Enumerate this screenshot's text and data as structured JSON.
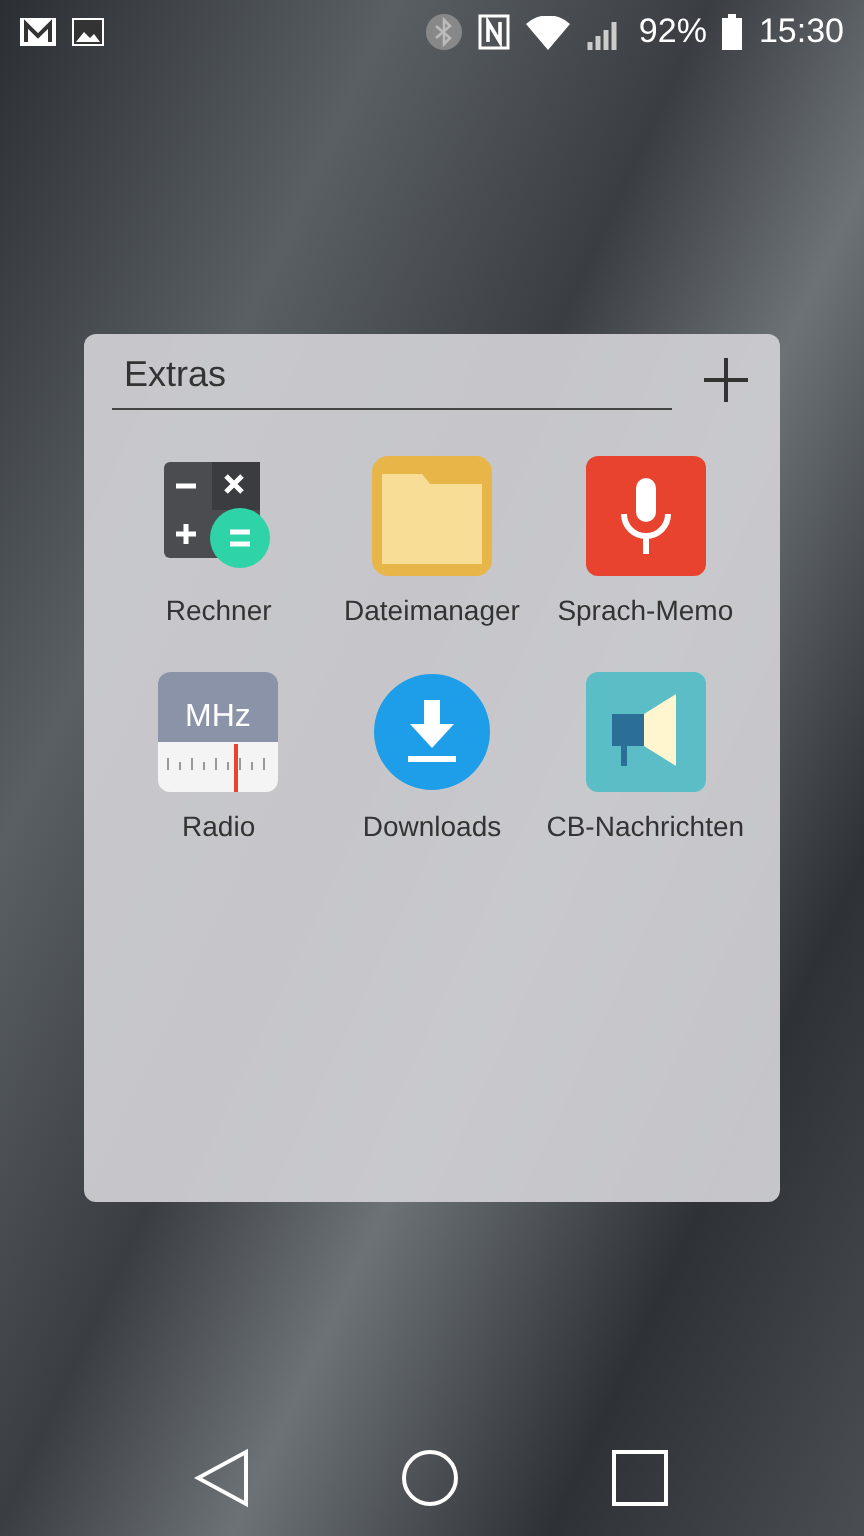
{
  "status_bar": {
    "battery": "92%",
    "time": "15:30"
  },
  "folder": {
    "title": "Extras",
    "apps": [
      {
        "kind": "calculator",
        "label": "Rechner"
      },
      {
        "kind": "folder",
        "label": "Dateimanager"
      },
      {
        "kind": "mic",
        "label": "Sprach-Memo"
      },
      {
        "kind": "radio",
        "label": "Radio",
        "icon_text": "MHz"
      },
      {
        "kind": "download",
        "label": "Downloads"
      },
      {
        "kind": "megaphone",
        "label": "CB-Nachrichten"
      }
    ]
  }
}
